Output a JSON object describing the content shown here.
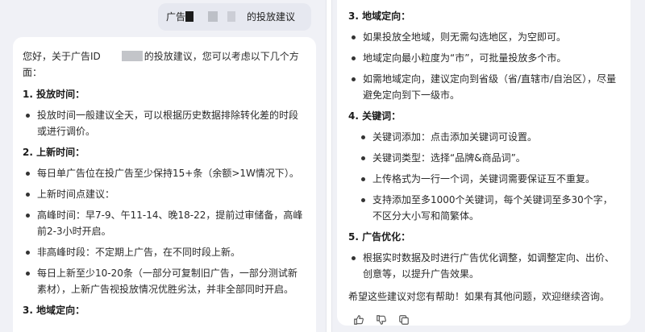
{
  "user_message": {
    "prefix": "广告",
    "suffix": "的投放建议"
  },
  "left": {
    "intro_a": "您好，关于广告ID",
    "intro_b": "的投放建议，您可以考虑以下几个方面：",
    "sections": [
      {
        "title": "1. 投放时间：",
        "items": [
          {
            "text": "投放时间一般建议全天，可以根据历史数据排除转化差的时段或进行调价。",
            "sub": false
          }
        ]
      },
      {
        "title": "2. 上新时间：",
        "items": [
          {
            "text": "每日单广告位在投广告至少保持15+条（余额>1W情况下）。",
            "sub": false
          },
          {
            "text": "上新时间点建议：",
            "sub": false
          },
          {
            "text": "高峰时间：早7-9、午11-14、晚18-22，提前过审储备，高峰前2-3小时开启。",
            "sub": false
          },
          {
            "text": "非高峰时段：不定期上广告，在不同时段上新。",
            "sub": false
          },
          {
            "text": "每日上新至少10-20条（一部分可复制旧广告，一部分测试新素材），上新广告视投放情况优胜劣汰，并非全部同时开启。",
            "sub": false
          }
        ]
      },
      {
        "title": "3. 地域定向：",
        "items": []
      }
    ]
  },
  "right": {
    "sections": [
      {
        "title": "3. 地域定向：",
        "items": [
          {
            "text": "如果投放全地域，则无需勾选地区，为空即可。",
            "sub": false
          },
          {
            "text": "地域定向最小粒度为“市”，可批量投放多个市。",
            "sub": false
          },
          {
            "text": "如需地域定向，建议定向到省级（省/直辖市/自治区），尽量避免定向到下一级市。",
            "sub": false
          }
        ]
      },
      {
        "title": "4. 关键词：",
        "items": [
          {
            "text": "关键词添加：点击添加关键词可设置。",
            "sub": true
          },
          {
            "text": "关键词类型：选择“品牌&商品词”。",
            "sub": true
          },
          {
            "text": "上传格式为一行一个词，关键词需要保证互不重复。",
            "sub": true
          },
          {
            "text": "支持添加至多1000个关键词，每个关键词至多30个字，不区分大小写和简繁体。",
            "sub": true
          }
        ]
      },
      {
        "title": "5. 广告优化：",
        "items": [
          {
            "text": "根据实时数据及时进行广告优化调整，如调整定向、出价、创意等，以提升广告效果。",
            "sub": false
          }
        ]
      }
    ],
    "closing": "希望这些建议对您有帮助！如果有其他问题，欢迎继续咨询。",
    "actions": [
      "thumbs-up-icon",
      "thumbs-down-icon",
      "copy-icon"
    ]
  }
}
